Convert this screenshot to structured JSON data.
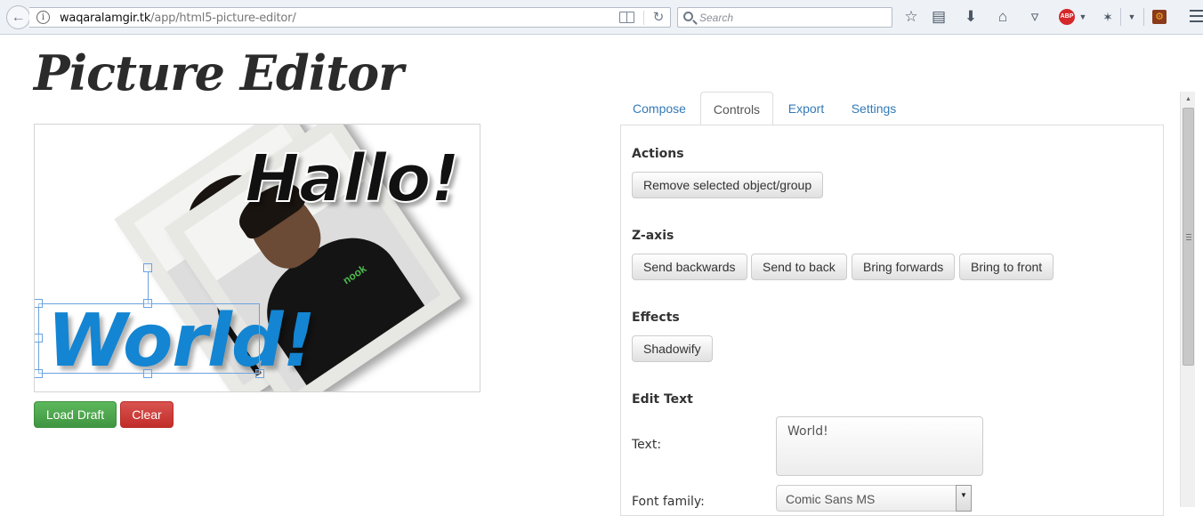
{
  "browser": {
    "url_host": "waqaralamgir.tk",
    "url_path": "/app/html5-picture-editor/",
    "search_placeholder": "Search",
    "abp_label": "ABP"
  },
  "page": {
    "title": "Picture Editor"
  },
  "canvas": {
    "text_objects": [
      "Hallo!",
      "World!"
    ],
    "photo_logo": "nook"
  },
  "canvas_buttons": {
    "load_draft": "Load Draft",
    "clear": "Clear"
  },
  "tabs": [
    {
      "label": "Compose",
      "active": false
    },
    {
      "label": "Controls",
      "active": true
    },
    {
      "label": "Export",
      "active": false
    },
    {
      "label": "Settings",
      "active": false
    }
  ],
  "controls": {
    "actions": {
      "heading": "Actions",
      "remove_label": "Remove selected object/group"
    },
    "zaxis": {
      "heading": "Z-axis",
      "send_backwards": "Send backwards",
      "send_to_back": "Send to back",
      "bring_forwards": "Bring forwards",
      "bring_to_front": "Bring to front"
    },
    "effects": {
      "heading": "Effects",
      "shadowify": "Shadowify"
    },
    "edit_text": {
      "heading": "Edit Text",
      "text_label": "Text:",
      "text_value": "World!",
      "font_family_label": "Font family:",
      "font_family_value": "Comic Sans MS"
    }
  },
  "colors": {
    "link_blue": "#337ab7",
    "success_green": "#5cb85c",
    "danger_red": "#d9534f",
    "world_text_blue": "#1385d2"
  }
}
